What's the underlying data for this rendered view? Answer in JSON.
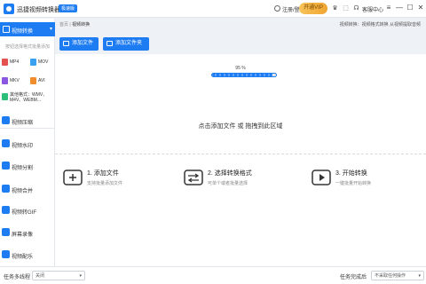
{
  "titlebar": {
    "app_title": "迅捷视频转换器",
    "badge": "极速版",
    "login": "注册/登录",
    "vip": "开通VIP",
    "help": "客服中心",
    "icons": [
      "crown-icon",
      "gift-icon",
      "menu-icon"
    ],
    "window_controls": [
      "—",
      "☐",
      "✕"
    ]
  },
  "sidebar": {
    "active": {
      "label": "视频转换",
      "icon": "video-convert-icon"
    },
    "hint": "按钮选择格式批量添加",
    "formats": [
      {
        "label": "MP4",
        "color": "#e55050"
      },
      {
        "label": "MOV",
        "color": "#3aa0f0"
      },
      {
        "label": "MKV",
        "color": "#8a56e2"
      },
      {
        "label": "AVI",
        "color": "#f08c2c"
      },
      {
        "label": "其他格式：WMV、M4V、WEBM...",
        "color": "#2cbf7a"
      }
    ],
    "items": [
      {
        "label": "视频压缩",
        "icon": "compress-icon"
      },
      {
        "label": "视频水印",
        "icon": "watermark-icon"
      },
      {
        "label": "视频分割",
        "icon": "split-icon"
      },
      {
        "label": "视频合并",
        "icon": "merge-icon"
      },
      {
        "label": "视频转GIF",
        "icon": "gif-icon"
      },
      {
        "label": "屏幕录像",
        "icon": "record-icon"
      },
      {
        "label": "视频配乐",
        "icon": "music-icon"
      }
    ]
  },
  "breadcrumb": {
    "home": "首页",
    "sep": "|",
    "current": "视频转换"
  },
  "header_right": "视频转换：视频格式转换 从视频提取音频",
  "toolbar": {
    "add_file": "添加文件",
    "add_folder": "添加文件夹"
  },
  "progress": {
    "label": "95 %",
    "value": 0.95
  },
  "drop_text": "点击添加文件 或 拖拽到此区域",
  "steps": [
    {
      "title": "1. 添加文件",
      "desc": "支持批量添加文件",
      "icon": "add-file-icon"
    },
    {
      "title": "2. 选择转换格式",
      "desc": "可单个或者批量选择",
      "icon": "convert-format-icon"
    },
    {
      "title": "3. 开始转换",
      "desc": "一键批量开始转换",
      "icon": "start-convert-icon"
    }
  ],
  "statusbar": {
    "multithread_label": "任务多线程",
    "multithread_value": "关闭",
    "done_label": "任务完成后",
    "done_value": "不采取任何操作"
  }
}
